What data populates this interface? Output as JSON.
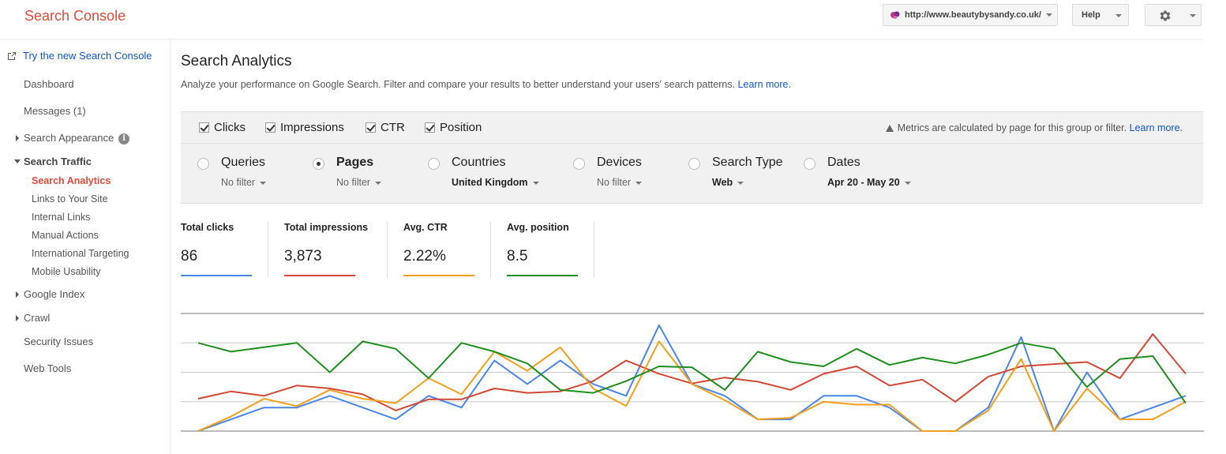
{
  "header": {
    "brand": "Search Console",
    "property_url": "http://www.beautybysandy.co.uk/",
    "help_label": "Help",
    "icons": {
      "settings": "gear-icon",
      "dropdown": "chevron-down-icon"
    }
  },
  "sidebar": {
    "try_new": "Try the new Search Console",
    "dashboard": "Dashboard",
    "messages": "Messages (1)",
    "search_appearance": "Search Appearance",
    "search_traffic": "Search Traffic",
    "search_traffic_items": [
      "Search Analytics",
      "Links to Your Site",
      "Internal Links",
      "Manual Actions",
      "International Targeting",
      "Mobile Usability"
    ],
    "google_index": "Google Index",
    "crawl": "Crawl",
    "security_issues": "Security Issues",
    "web_tools": "Web Tools",
    "active_item": "Search Analytics"
  },
  "main": {
    "title": "Search Analytics",
    "description": "Analyze your performance on Google Search. Filter and compare your results to better understand your users' search patterns.",
    "learn_more": "Learn more."
  },
  "metrics": {
    "checkboxes": [
      {
        "label": "Clicks",
        "checked": true
      },
      {
        "label": "Impressions",
        "checked": true
      },
      {
        "label": "CTR",
        "checked": true
      },
      {
        "label": "Position",
        "checked": true
      }
    ],
    "note": "Metrics are calculated by page for this group or filter.",
    "note_link": "Learn more."
  },
  "filters": [
    {
      "label": "Queries",
      "value": "No filter",
      "selected": false
    },
    {
      "label": "Pages",
      "value": "No filter",
      "selected": true
    },
    {
      "label": "Countries",
      "value": "United Kingdom",
      "selected": false
    },
    {
      "label": "Devices",
      "value": "No filter",
      "selected": false
    },
    {
      "label": "Search Type",
      "value": "Web",
      "selected": false
    },
    {
      "label": "Dates",
      "value": "Apr 20 - May 20",
      "selected": false
    }
  ],
  "totals": [
    {
      "label": "Total clicks",
      "value": "86",
      "color": "#4a86e8"
    },
    {
      "label": "Total impressions",
      "value": "3,873",
      "color": "#d14836"
    },
    {
      "label": "Avg. CTR",
      "value": "2.22%",
      "color": "#f29f1c"
    },
    {
      "label": "Avg. position",
      "value": "8.5",
      "color": "#1e8e1e"
    }
  ],
  "chart_data": {
    "type": "line",
    "grid": true,
    "ylim": [
      0,
      4
    ],
    "series": [
      {
        "values": [
          0,
          0.4,
          0.8,
          0.8,
          1.2,
          0.8,
          0.4,
          1.2,
          0.8,
          2.4,
          1.6,
          2.4,
          1.6,
          1.2,
          3.6,
          1.6,
          1.2,
          0.4,
          0.4,
          1.2,
          1.2,
          0.8,
          0,
          0,
          0.8,
          3.2,
          0,
          2.0,
          0.4,
          0.8,
          1.2
        ],
        "color": "#4a86e8"
      },
      {
        "values": [
          1.1,
          1.35,
          1.2,
          1.55,
          1.45,
          1.25,
          0.7,
          1.08,
          1.08,
          1.45,
          1.3,
          1.35,
          1.7,
          2.4,
          1.95,
          1.62,
          1.82,
          1.68,
          1.4,
          1.95,
          2.2,
          1.55,
          1.75,
          1.0,
          1.85,
          2.2,
          2.28,
          2.35,
          1.8,
          3.3,
          1.95
        ],
        "color": "#d14836"
      },
      {
        "values": [
          0,
          0.5,
          1.1,
          0.85,
          1.4,
          1.1,
          0.95,
          1.8,
          1.25,
          2.7,
          2.05,
          2.85,
          1.45,
          0.85,
          3.05,
          1.6,
          1.05,
          0.4,
          0.45,
          1.0,
          0.9,
          0.9,
          0,
          0,
          0.7,
          2.45,
          0,
          1.45,
          0.4,
          0.4,
          1.0
        ],
        "color": "#f29f1c"
      },
      {
        "values": [
          3.0,
          2.7,
          2.85,
          3.0,
          2.0,
          3.05,
          2.8,
          1.8,
          3.0,
          2.7,
          2.3,
          1.4,
          1.3,
          1.7,
          2.2,
          2.17,
          1.4,
          2.7,
          2.35,
          2.2,
          2.8,
          2.25,
          2.5,
          2.3,
          2.6,
          3.0,
          2.8,
          1.5,
          2.45,
          2.55,
          0.95
        ],
        "color": "#1e8e1e"
      }
    ]
  }
}
